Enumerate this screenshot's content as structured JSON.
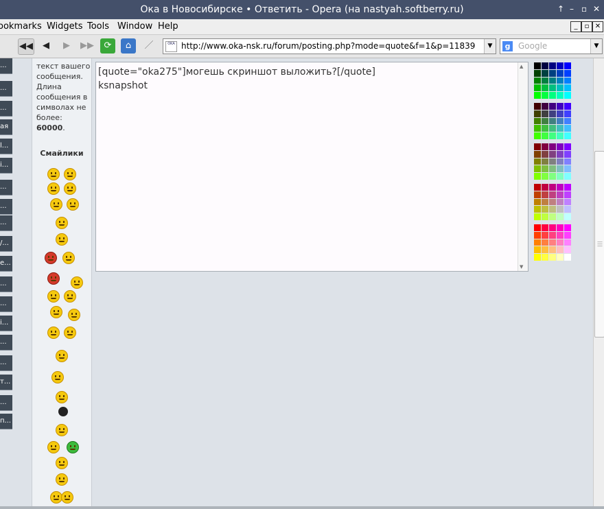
{
  "window": {
    "title": "Ока в Новосибирске • Ответить - Opera (на nastyah.softberry.ru)"
  },
  "menu": {
    "items": [
      "ookmarks",
      "Widgets",
      "Tools",
      "Window",
      "Help"
    ]
  },
  "address": {
    "url": "http://www.oka-nsk.ru/forum/posting.php?mode=quote&f=1&p=11839",
    "favicon_text": "OKA"
  },
  "search": {
    "placeholder": "Google"
  },
  "left_nav": {
    "items": [
      "...",
      "...",
      "...",
      "ая",
      "l...",
      "i...",
      "...",
      "...",
      "...",
      "/...",
      "е...",
      "...",
      "...",
      "i...",
      "...",
      "...",
      "т...",
      "...",
      "п..."
    ]
  },
  "side": {
    "info": "текст вашего сообщения. Длина сообщения в символах не более:",
    "max_len": "60000",
    "smilies_heading": "Смайлики"
  },
  "editor": {
    "content": "[quote=\"oka275\"]могешь скриншот выложить?[/quote]\nksnapshot"
  },
  "colors": {
    "palette_rows": [
      [
        "#000000",
        "#000040",
        "#000080",
        "#0000bf",
        "#0000ff"
      ],
      [
        "#004000",
        "#004040",
        "#004080",
        "#0040bf",
        "#0040ff"
      ],
      [
        "#008000",
        "#008040",
        "#008080",
        "#0080bf",
        "#0080ff"
      ],
      [
        "#00bf00",
        "#00bf40",
        "#00bf80",
        "#00bfbf",
        "#00bfff"
      ],
      [
        "#00ff00",
        "#00ff40",
        "#00ff80",
        "#00ffbf",
        "#00ffff"
      ],
      [
        "#400000",
        "#400040",
        "#400080",
        "#4000bf",
        "#4000ff"
      ],
      [
        "#404000",
        "#404040",
        "#404080",
        "#4040bf",
        "#4040ff"
      ],
      [
        "#408000",
        "#408040",
        "#408080",
        "#4080bf",
        "#4080ff"
      ],
      [
        "#40bf00",
        "#40bf40",
        "#40bf80",
        "#40bfbf",
        "#40bfff"
      ],
      [
        "#40ff00",
        "#40ff40",
        "#40ff80",
        "#40ffbf",
        "#40ffff"
      ],
      [
        "#800000",
        "#800040",
        "#800080",
        "#8000bf",
        "#8000ff"
      ],
      [
        "#804000",
        "#804040",
        "#804080",
        "#8040bf",
        "#8040ff"
      ],
      [
        "#808000",
        "#808040",
        "#808080",
        "#8080bf",
        "#8080ff"
      ],
      [
        "#80bf00",
        "#80bf40",
        "#80bf80",
        "#80bfbf",
        "#80bfff"
      ],
      [
        "#80ff00",
        "#80ff40",
        "#80ff80",
        "#80ffbf",
        "#80ffff"
      ],
      [
        "#bf0000",
        "#bf0040",
        "#bf0080",
        "#bf00bf",
        "#bf00ff"
      ],
      [
        "#bf4000",
        "#bf4040",
        "#bf4080",
        "#bf40bf",
        "#bf40ff"
      ],
      [
        "#bf8000",
        "#bf8040",
        "#bf8080",
        "#bf80bf",
        "#bf80ff"
      ],
      [
        "#bfbf00",
        "#bfbf40",
        "#bfbf80",
        "#bfbfbf",
        "#bfbfff"
      ],
      [
        "#bfff00",
        "#bfff40",
        "#bfff80",
        "#bfffbf",
        "#bfffff"
      ],
      [
        "#ff0000",
        "#ff0040",
        "#ff0080",
        "#ff00bf",
        "#ff00ff"
      ],
      [
        "#ff4000",
        "#ff4040",
        "#ff4080",
        "#ff40bf",
        "#ff40ff"
      ],
      [
        "#ff8000",
        "#ff8040",
        "#ff8080",
        "#ff80bf",
        "#ff80ff"
      ],
      [
        "#ffbf00",
        "#ffbf40",
        "#ffbf80",
        "#ffbfbf",
        "#ffbfff"
      ],
      [
        "#ffff00",
        "#ffff40",
        "#ffff80",
        "#ffffbf",
        "#ffffff"
      ]
    ],
    "title_bar": "#44506a",
    "side_nav": "#3f4a56"
  }
}
